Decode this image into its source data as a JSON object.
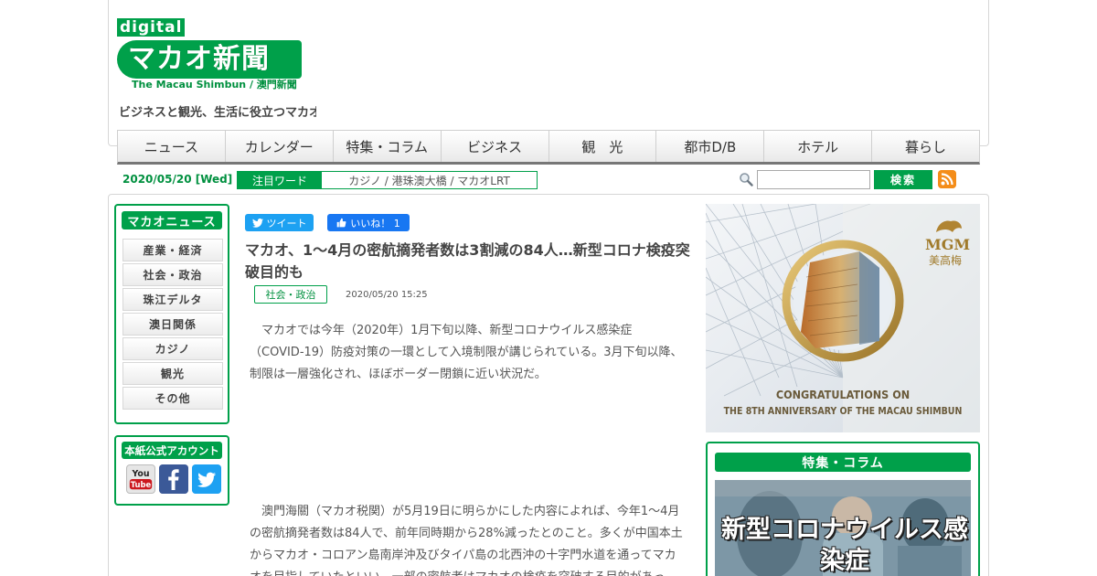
{
  "site": {
    "logo_digital": "digital",
    "logo_main": "マカオ新聞",
    "logo_sub": "The Macau Shimbun / 澳門新聞",
    "tagline": "ビジネスと観光、生活に役立つマカオ"
  },
  "nav": {
    "items": [
      "ニュース",
      "カレンダー",
      "特集・コラム",
      "ビジネス",
      "観　光",
      "都市D/B",
      "ホテル",
      "暮らし"
    ]
  },
  "subbar": {
    "date": "2020/05/20 [Wed]",
    "trend_label": "注目ワード",
    "trend_words": "カジノ / 港珠澳大橋 / マカオLRT",
    "search_placeholder": "",
    "search_button": "検索"
  },
  "sidebar": {
    "news_title": "マカオニュース",
    "categories": [
      "産業・経済",
      "社会・政治",
      "珠江デルタ",
      "澳日関係",
      "カジノ",
      "観光",
      "その他"
    ],
    "account_title": "本紙公式アカウント",
    "social": [
      "youtube-icon",
      "facebook-icon",
      "twitter-icon"
    ]
  },
  "article": {
    "tweet_label": "ツイート",
    "like_label": "いいね！ 1",
    "title": "マカオ、1〜4月の密航摘発者数は3割減の84人…新型コロナ検疫突破目的も",
    "category": "社会・政治",
    "published": "2020/05/20 15:25",
    "para1": "マカオでは今年（2020年）1月下旬以降、新型コロナウイルス感染症（COVID-19）防疫対策の一環として入境制限が講じられている。3月下旬以降、制限は一層強化され、ほぼボーダー閉鎖に近い状況だ。",
    "para2": "澳門海關（マカオ税関）が5月19日に明らかにした内容によれば、今年1〜4月の密航摘発者数は84人で、前年同時期から28%減ったとのこと。多くが中国本土からマカオ・コロアン島南岸沖及びタイパ島の北西沖の十字門水道を通ってマカオを目指していたといい、一部の密航者はマカオの検疫を突破する目的があっ"
  },
  "ad": {
    "line1": "CONGRATULATIONS ON",
    "line2": "THE 8TH ANNIVERSARY OF THE MACAU SHIMBUN",
    "brand": "MGM",
    "brand_cn": "美高梅"
  },
  "feature": {
    "title": "特集・コラム",
    "image_text": "新型コロナウイルス感染症"
  },
  "colors": {
    "brand_green": "#00a04a",
    "text_dark": "#444444",
    "twitter": "#1da1f2",
    "facebook": "#1877f2",
    "rss": "#f48d1a"
  }
}
